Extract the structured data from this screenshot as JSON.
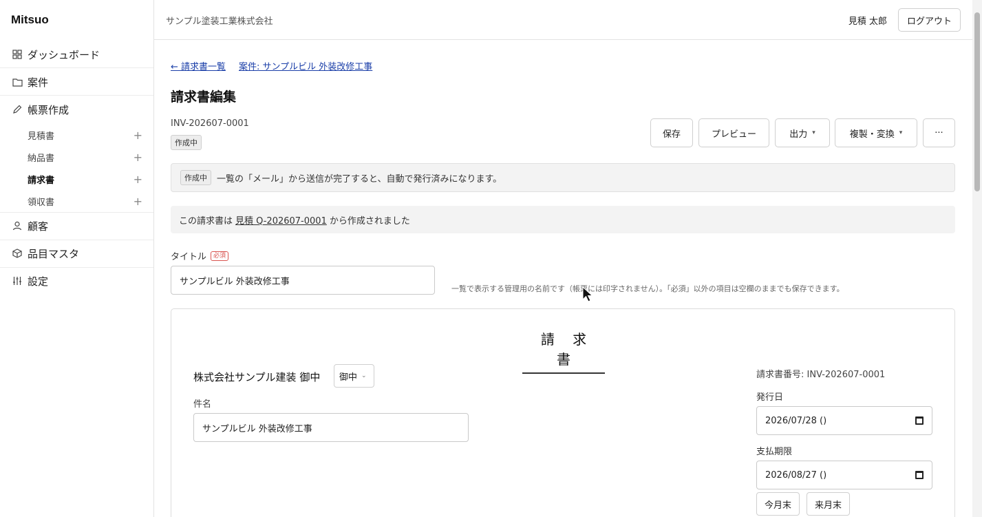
{
  "app": {
    "name": "Mitsuo"
  },
  "sidebar": {
    "nav": [
      {
        "label": "ダッシュボード",
        "icon": "grid-icon"
      },
      {
        "label": "案件",
        "icon": "folder-icon"
      },
      {
        "label": "帳票作成",
        "icon": "pencil-icon"
      }
    ],
    "sub_items": [
      {
        "label": "見積書",
        "active": false
      },
      {
        "label": "納品書",
        "active": false
      },
      {
        "label": "請求書",
        "active": true
      },
      {
        "label": "領収書",
        "active": false
      }
    ],
    "nav_bottom": [
      {
        "label": "顧客",
        "icon": "person-icon"
      },
      {
        "label": "品目マスタ",
        "icon": "box-icon"
      },
      {
        "label": "設定",
        "icon": "sliders-icon"
      }
    ]
  },
  "header": {
    "company": "サンプル塗装工業株式会社",
    "user_name": "見積 太郎",
    "logout_label": "ログアウト"
  },
  "breadcrumb": {
    "back_link": "← 請求書一覧",
    "project_link": "案件: サンプルビル 外装改修工事"
  },
  "page": {
    "title": "請求書編集",
    "doc_number": "INV-202607-0001",
    "status": "作成中"
  },
  "toolbar": {
    "save": "保存",
    "preview": "プレビュー",
    "output": "出力",
    "duplicate_convert": "複製・変換",
    "more": "···"
  },
  "notice": {
    "status_badge": "作成中",
    "message": "一覧の「メール」から送信が完了すると、自動で発行済みになります。"
  },
  "source_info": {
    "prefix": "この請求書は",
    "link": "見積 Q-202607-0001",
    "suffix": "から作成されました"
  },
  "title_field": {
    "label": "タイトル",
    "required_badge": "必須",
    "value": "サンプルビル 外装改修工事",
    "help": "一覧で表示する管理用の名前です（帳票には印字されません）。「必須」以外の項目は空欄のままでも保存できます。"
  },
  "invoice": {
    "heading": "請 求 書",
    "customer": "株式会社サンプル建装 御中",
    "honorific": "御中",
    "subject_label": "件名",
    "subject_value": "サンプルビル 外装改修工事",
    "invoice_number": "請求書番号: INV-202607-0001",
    "issue_date_label": "発行日",
    "issue_date": "2026/07/28 ()",
    "due_date_label": "支払期限",
    "due_date": "2026/08/27 ()",
    "this_month_end": "今月末",
    "next_month_end": "来月末"
  }
}
